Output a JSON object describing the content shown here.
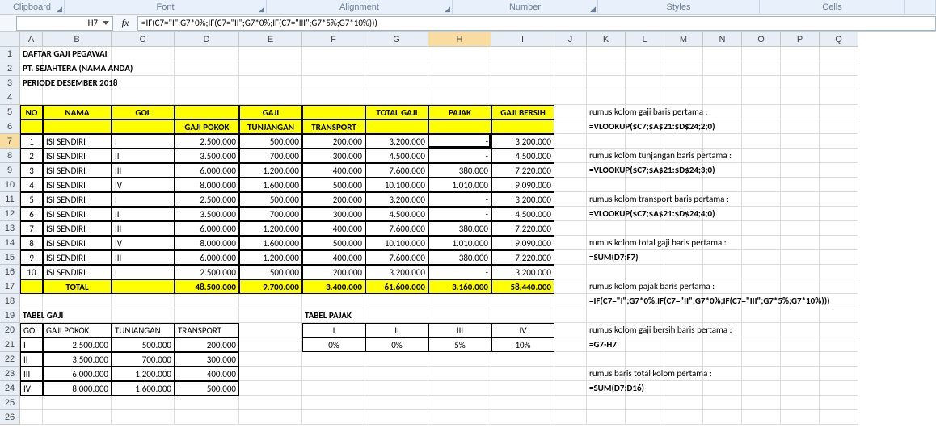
{
  "ribbon": {
    "clipboard": "Clipboard",
    "font": "Font",
    "alignment": "Alignment",
    "number": "Number",
    "styles": "Styles",
    "cells": "Cells"
  },
  "name_box": "H7",
  "fx_label": "fx",
  "formula": "=IF(C7=\"I\";G7*0%;IF(C7=\"II\";G7*0%;IF(C7=\"III\";G7*5%;G7*10%)))",
  "columns": [
    "A",
    "B",
    "C",
    "D",
    "E",
    "F",
    "G",
    "H",
    "I",
    "J",
    "K",
    "L",
    "M",
    "N",
    "O",
    "P",
    "Q"
  ],
  "row_ids": [
    "1",
    "2",
    "3",
    "4",
    "5",
    "6",
    "7",
    "8",
    "9",
    "10",
    "11",
    "12",
    "13",
    "14",
    "15",
    "16",
    "17",
    "18",
    "19",
    "20",
    "21",
    "22",
    "23",
    "24",
    "25",
    "26"
  ],
  "title_lines": {
    "l1": "DAFTAR GAJI PEGAWAI",
    "l2": "PT. SEJAHTERA (NAMA ANDA)",
    "l3": "PERIODE DESEMBER 2018"
  },
  "main_hdr": {
    "no": "NO",
    "nama": "NAMA",
    "gol": "GOL",
    "gaji": "GAJI",
    "gaji_pokok": "GAJI POKOK",
    "tunjangan": "TUNJANGAN",
    "transport": "TRANSPORT",
    "total_gaji": "TOTAL GAJI",
    "pajak": "PAJAK",
    "gaji_bersih": "GAJI BERSIH"
  },
  "main_rows": [
    {
      "no": "1",
      "nama": "ISI SENDIRI",
      "gol": "I",
      "gp": "2.500.000",
      "tj": "500.000",
      "tr": "200.000",
      "tg": "3.200.000",
      "pj": "-",
      "gb": "3.200.000"
    },
    {
      "no": "2",
      "nama": "ISI SENDIRI",
      "gol": "II",
      "gp": "3.500.000",
      "tj": "700.000",
      "tr": "300.000",
      "tg": "4.500.000",
      "pj": "-",
      "gb": "4.500.000"
    },
    {
      "no": "3",
      "nama": "ISI SENDIRI",
      "gol": "III",
      "gp": "6.000.000",
      "tj": "1.200.000",
      "tr": "400.000",
      "tg": "7.600.000",
      "pj": "380.000",
      "gb": "7.220.000"
    },
    {
      "no": "4",
      "nama": "ISI SENDIRI",
      "gol": "IV",
      "gp": "8.000.000",
      "tj": "1.600.000",
      "tr": "500.000",
      "tg": "10.100.000",
      "pj": "1.010.000",
      "gb": "9.090.000"
    },
    {
      "no": "5",
      "nama": "ISI SENDIRI",
      "gol": "I",
      "gp": "2.500.000",
      "tj": "500.000",
      "tr": "200.000",
      "tg": "3.200.000",
      "pj": "-",
      "gb": "3.200.000"
    },
    {
      "no": "6",
      "nama": "ISI SENDIRI",
      "gol": "II",
      "gp": "3.500.000",
      "tj": "700.000",
      "tr": "300.000",
      "tg": "4.500.000",
      "pj": "-",
      "gb": "4.500.000"
    },
    {
      "no": "7",
      "nama": "ISI SENDIRI",
      "gol": "III",
      "gp": "6.000.000",
      "tj": "1.200.000",
      "tr": "400.000",
      "tg": "7.600.000",
      "pj": "380.000",
      "gb": "7.220.000"
    },
    {
      "no": "8",
      "nama": "ISI SENDIRI",
      "gol": "IV",
      "gp": "8.000.000",
      "tj": "1.600.000",
      "tr": "500.000",
      "tg": "10.100.000",
      "pj": "1.010.000",
      "gb": "9.090.000"
    },
    {
      "no": "9",
      "nama": "ISI SENDIRI",
      "gol": "III",
      "gp": "6.000.000",
      "tj": "1.200.000",
      "tr": "400.000",
      "tg": "7.600.000",
      "pj": "380.000",
      "gb": "7.220.000"
    },
    {
      "no": "10",
      "nama": "ISI SENDIRI",
      "gol": "I",
      "gp": "2.500.000",
      "tj": "500.000",
      "tr": "200.000",
      "tg": "3.200.000",
      "pj": "-",
      "gb": "3.200.000"
    }
  ],
  "total_row": {
    "label": "TOTAL",
    "gp": "48.500.000",
    "tj": "9.700.000",
    "tr": "3.400.000",
    "tg": "61.600.000",
    "pj": "3.160.000",
    "gb": "58.440.000"
  },
  "tabel_gaji": {
    "title": "TABEL GAJI",
    "hdr": [
      "GOL",
      "GAJI POKOK",
      "TUNJANGAN",
      "TRANSPORT"
    ],
    "rows": [
      {
        "gol": "I",
        "gp": "2.500.000",
        "tj": "500.000",
        "tr": "200.000"
      },
      {
        "gol": "II",
        "gp": "3.500.000",
        "tj": "700.000",
        "tr": "300.000"
      },
      {
        "gol": "III",
        "gp": "6.000.000",
        "tj": "1.200.000",
        "tr": "400.000"
      },
      {
        "gol": "IV",
        "gp": "8.000.000",
        "tj": "1.600.000",
        "tr": "500.000"
      }
    ]
  },
  "tabel_pajak": {
    "title": "TABEL PAJAK",
    "hdr": [
      "I",
      "II",
      "III",
      "IV"
    ],
    "vals": [
      "0%",
      "0%",
      "5%",
      "10%"
    ]
  },
  "notes": {
    "n1": "rumus kolom gaji baris pertama :",
    "f1": "=VLOOKUP($C7;$A$21:$D$24;2;0)",
    "n2": "rumus kolom tunjangan baris pertama :",
    "f2": "=VLOOKUP($C7;$A$21:$D$24;3;0)",
    "n3": "rumus kolom transport baris pertama :",
    "f3": "=VLOOKUP($C7;$A$21:$D$24;4;0)",
    "n4": "rumus kolom total gaji baris pertama :",
    "f4": "=SUM(D7:F7)",
    "n5": "rumus kolom pajak baris pertama :",
    "f5": "=IF(C7=\"I\";G7*0%;IF(C7=\"II\";G7*0%;IF(C7=\"III\";G7*5%;G7*10%)))",
    "n6": "rumus kolom gaji bersih baris pertama :",
    "f6": "=G7-H7",
    "n7": "rumus baris total kolom pertama :",
    "f7": "=SUM(D7:D16)"
  }
}
